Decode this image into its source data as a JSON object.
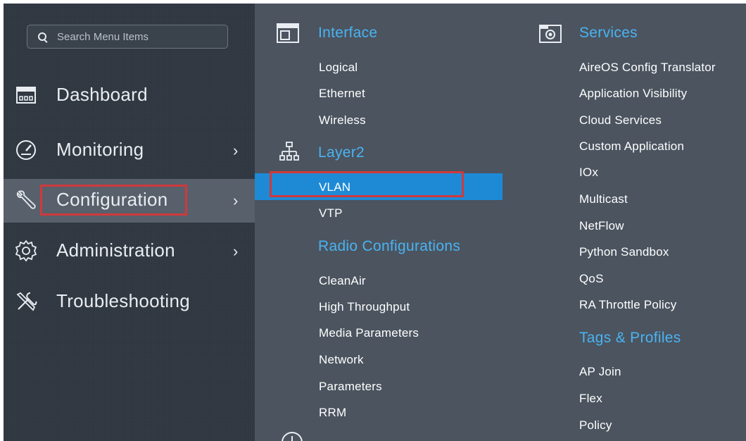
{
  "search": {
    "placeholder": "Search Menu Items"
  },
  "sidebar": {
    "items": [
      {
        "label": "Dashboard",
        "icon": "dashboard-icon",
        "has_chevron": false
      },
      {
        "label": "Monitoring",
        "icon": "gauge-icon",
        "has_chevron": true,
        "chevron": "›"
      },
      {
        "label": "Configuration",
        "icon": "wrench-icon",
        "has_chevron": true,
        "chevron": "›",
        "active": true
      },
      {
        "label": "Administration",
        "icon": "gear-icon",
        "has_chevron": true,
        "chevron": "›"
      },
      {
        "label": "Troubleshooting",
        "icon": "tools-icon",
        "has_chevron": false
      }
    ]
  },
  "menu": {
    "col1": {
      "interface": {
        "title": "Interface",
        "items": [
          "Logical",
          "Ethernet",
          "Wireless"
        ]
      },
      "layer2": {
        "title": "Layer2",
        "items": [
          "VLAN",
          "VTP"
        ],
        "selected": "VLAN"
      },
      "radio": {
        "title": "Radio Configurations",
        "items": [
          "CleanAir",
          "High Throughput",
          "Media Parameters",
          "Network",
          "Parameters",
          "RRM"
        ]
      }
    },
    "col2": {
      "services": {
        "title": "Services",
        "items": [
          "AireOS Config Translator",
          "Application Visibility",
          "Cloud Services",
          "Custom Application",
          "IOx",
          "Multicast",
          "NetFlow",
          "Python Sandbox",
          "QoS",
          "RA Throttle Policy"
        ]
      },
      "tags": {
        "title": "Tags & Profiles",
        "items": [
          "AP Join",
          "Flex",
          "Policy"
        ]
      }
    }
  },
  "colors": {
    "accent": "#4ab3f2",
    "highlight": "#1e8ad6",
    "annotation": "#d0393c",
    "sidebar_bg": "#2f3640",
    "panel_bg": "#4b545f"
  }
}
